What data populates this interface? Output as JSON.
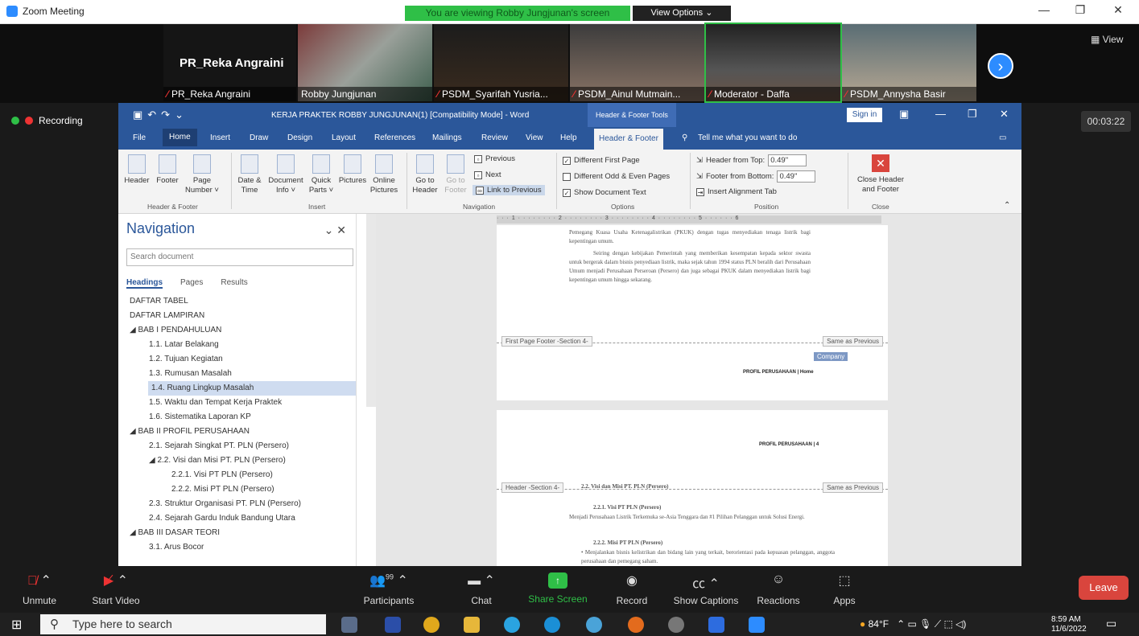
{
  "window": {
    "title": "Zoom Meeting",
    "viewing": "You are viewing Robby Jungjunan's screen",
    "view_options": "View Options ⌄"
  },
  "gallery": {
    "name_big": "PR_Reka Angraini",
    "tiles": [
      "PR_Reka Angraini",
      "Robby Jungjunan",
      "PSDM_Syarifah Yusria...",
      "PSDM_Ainul Mutmain...",
      "Moderator - Daffa",
      "PSDM_Annysha Basir"
    ],
    "view_label": "View"
  },
  "recording": "Recording",
  "timer": "00:03:22",
  "word": {
    "title": "KERJA PRAKTEK ROBBY JUNGJUNAN(1) [Compatibility Mode] - Word",
    "context_tab": "Header & Footer Tools",
    "sign_in": "Sign in",
    "tabs": [
      "File",
      "Home",
      "Insert",
      "Draw",
      "Design",
      "Layout",
      "References",
      "Mailings",
      "Review",
      "View",
      "Help",
      "Header & Footer"
    ],
    "tell_me": "Tell me what you want to do",
    "ribbon": {
      "header": "Header",
      "footer": "Footer",
      "page_number": "Page Number ˅",
      "grp_hf": "Header & Footer",
      "date_time": "Date & Time",
      "doc_info": "Document Info ˅",
      "quick_parts": "Quick Parts ˅",
      "pictures": "Pictures",
      "online_pictures": "Online Pictures",
      "grp_insert": "Insert",
      "goto_header": "Go to Header",
      "goto_footer": "Go to Footer",
      "previous": "Previous",
      "next": "Next",
      "link_prev": "Link to Previous",
      "grp_nav": "Navigation",
      "diff_first": "Different First Page",
      "diff_odd": "Different Odd & Even Pages",
      "show_doc": "Show Document Text",
      "grp_options": "Options",
      "header_top": "Header from Top:",
      "header_top_val": "0.49\"",
      "footer_bottom": "Footer from Bottom:",
      "footer_bottom_val": "0.49\"",
      "insert_align": "Insert Alignment Tab",
      "grp_position": "Position",
      "close": "Close Header and Footer",
      "grp_close": "Close"
    },
    "nav": {
      "title": "Navigation",
      "search_placeholder": "Search document",
      "tabs": [
        "Headings",
        "Pages",
        "Results"
      ],
      "items": [
        {
          "text": "DAFTAR TABEL",
          "level": 0
        },
        {
          "text": "DAFTAR LAMPIRAN",
          "level": 0
        },
        {
          "text": "◢ BAB I  PENDAHULUAN",
          "level": 0
        },
        {
          "text": "1.1.  Latar Belakang",
          "level": 1
        },
        {
          "text": "1.2.  Tujuan Kegiatan",
          "level": 1
        },
        {
          "text": "1.3.  Rumusan Masalah",
          "level": 1
        },
        {
          "text": "1.4.  Ruang Lingkup Masalah",
          "level": 1,
          "selected": true
        },
        {
          "text": "1.5.  Waktu dan Tempat Kerja Praktek",
          "level": 1
        },
        {
          "text": "1.6.  Sistematika Laporan KP",
          "level": 1
        },
        {
          "text": "◢ BAB II  PROFIL PERUSAHAAN",
          "level": 0
        },
        {
          "text": "2.1.  Sejarah Singkat PT. PLN (Persero)",
          "level": 1
        },
        {
          "text": "◢ 2.2.  Visi dan Misi PT. PLN (Persero)",
          "level": 1
        },
        {
          "text": "2.2.1.  Visi PT PLN (Persero)",
          "level": 2
        },
        {
          "text": "2.2.2.  Misi PT PLN (Persero)",
          "level": 2
        },
        {
          "text": "2.3.  Struktur Organisasi PT. PLN (Persero)",
          "level": 1
        },
        {
          "text": "2.4.  Sejarah Gardu Induk Bandung Utara",
          "level": 1
        },
        {
          "text": "◢ BAB III  DASAR TEORI",
          "level": 0
        },
        {
          "text": "3.1.  Arus Bocor",
          "level": 1
        }
      ]
    },
    "ruler": "· · · 1 · · · · · · · · 2 · · · · · · · · 3 · · · · · · · · 4 · · · · · · · · 5 · · · · · · 6",
    "page1": {
      "p1": "Pemegang Kuasa Usaha Ketenagalistrikan (PKUK) dengan tugas menyediakan tenaga listrik bagi kepentingan umum.",
      "p2": "Seiring dengan kebijakan Pemerintah yang memberikan kesempatan kepada sektor swasta untuk bergerak dalam bisnis penyediaan listrik, maka sejak tahun 1994 status PLN beralih dari Perusahaan Umum menjadi Perusahaan Perseroan (Persero) dan juga sebagai PKUK dalam menyediakan listrik bagi kepentingan umum hingga sekarang.",
      "footer_tag": "First Page Footer -Section 4-",
      "same": "Same as Previous",
      "company": "Company",
      "footer_text": "PROFIL PERUSAHAAN | Home"
    },
    "page2": {
      "header_text": "PROFIL PERUSAHAAN | 4",
      "header_tag": "Header -Section 4-",
      "same": "Same as Previous",
      "h1": "2.2.  Visi dan Misi PT. PLN (Persero)",
      "h2": "2.2.1.  Visi PT PLN (Persero)",
      "p1": "Menjadi Perusahaan Listrik Terkemuka se-Asia Tenggara dan #1 Pilihan Pelanggan untuk Solusi Energi.",
      "h3": "2.2.2.  Misi PT PLN (Persero)",
      "p2": "•  Menjalankan bisnis kelistrikan dan bidang lain yang terkait, berorientasi pada kepuasan pelanggan, anggota perusahaan dan pemegang saham."
    }
  },
  "controls": {
    "unmute": "Unmute",
    "video": "Start Video",
    "participants": "Participants",
    "participants_count": "99",
    "chat": "Chat",
    "share": "Share Screen",
    "record": "Record",
    "captions": "Show Captions",
    "reactions": "Reactions",
    "apps": "Apps",
    "leave": "Leave"
  },
  "taskbar": {
    "search": "Type here to search",
    "temp": "84°F",
    "time": "8:59 AM",
    "date": "11/6/2022"
  }
}
